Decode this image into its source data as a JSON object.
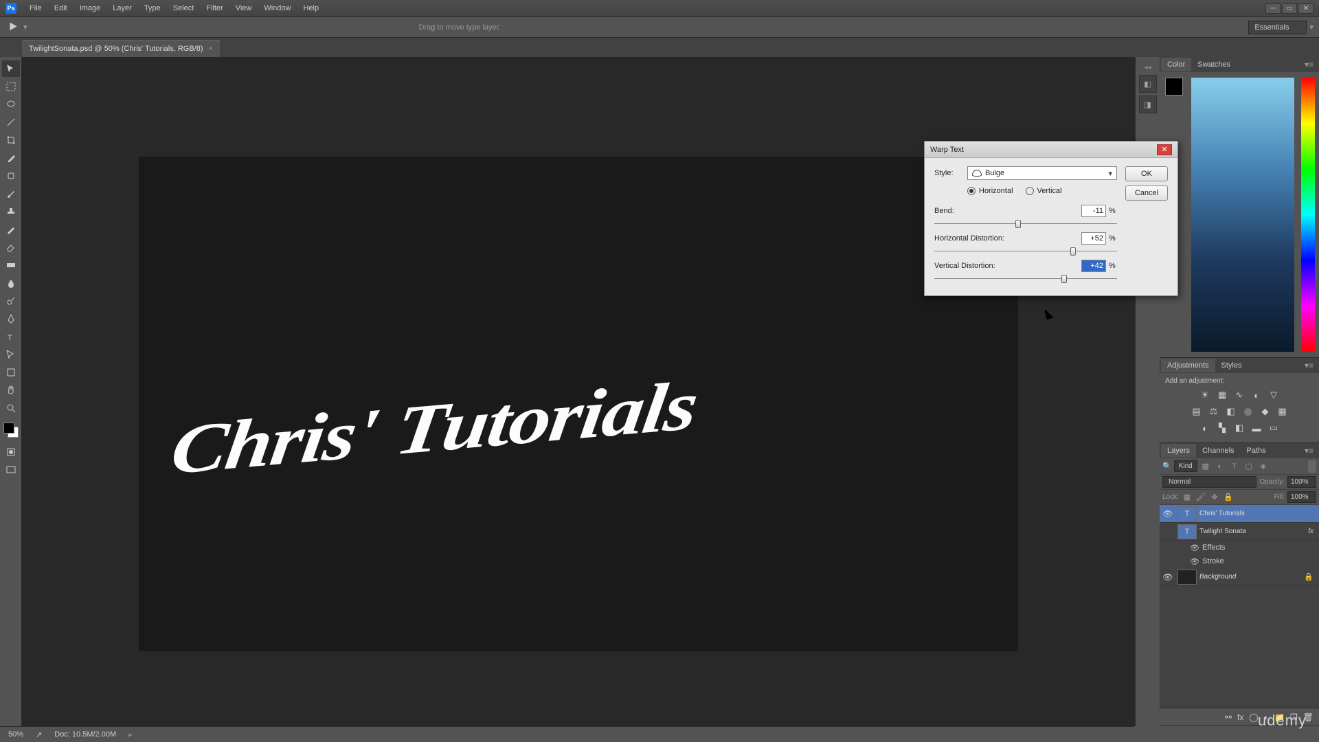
{
  "menubar": [
    "File",
    "Edit",
    "Image",
    "Layer",
    "Type",
    "Select",
    "Filter",
    "View",
    "Window",
    "Help"
  ],
  "optionsHint": "Drag to move type layer.",
  "workspace": "Essentials",
  "docTab": "TwilightSonata.psd @ 50% (Chris' Tutorials, RGB/8)",
  "canvasText": "Chris' Tutorials",
  "dialog": {
    "title": "Warp Text",
    "styleLabel": "Style:",
    "styleValue": "Bulge",
    "horiz": "Horizontal",
    "vert": "Vertical",
    "ok": "OK",
    "cancel": "Cancel",
    "params": [
      {
        "label": "Bend:",
        "value": "-11",
        "thumb": 46,
        "sel": false
      },
      {
        "label": "Horizontal Distortion:",
        "value": "+52",
        "thumb": 76,
        "sel": false
      },
      {
        "label": "Vertical Distortion:",
        "value": "+42",
        "thumb": 71,
        "sel": true
      }
    ]
  },
  "panels": {
    "colorTabs": [
      "Color",
      "Swatches"
    ],
    "adjTabs": [
      "Adjustments",
      "Styles"
    ],
    "adjLabel": "Add an adjustment:",
    "layerTabs": [
      "Layers",
      "Channels",
      "Paths"
    ],
    "kind": "Kind",
    "blend": "Normal",
    "opacityLbl": "Opacity:",
    "opacity": "100%",
    "lockLbl": "Lock:",
    "fillLbl": "Fill:",
    "fill": "100%",
    "layers": [
      {
        "name": "Chris' Tutorials",
        "type": "T",
        "vis": true,
        "sel": true
      },
      {
        "name": "Twilight Sonata",
        "type": "T",
        "vis": false,
        "fx": true
      },
      {
        "name": "Background",
        "type": "bg",
        "vis": true,
        "lock": true
      }
    ],
    "fxLabel": "Effects",
    "strokeLabel": "Stroke"
  },
  "status": {
    "zoom": "50%",
    "doc": "Doc: 10.5M/2.00M"
  },
  "brand": "udemy"
}
